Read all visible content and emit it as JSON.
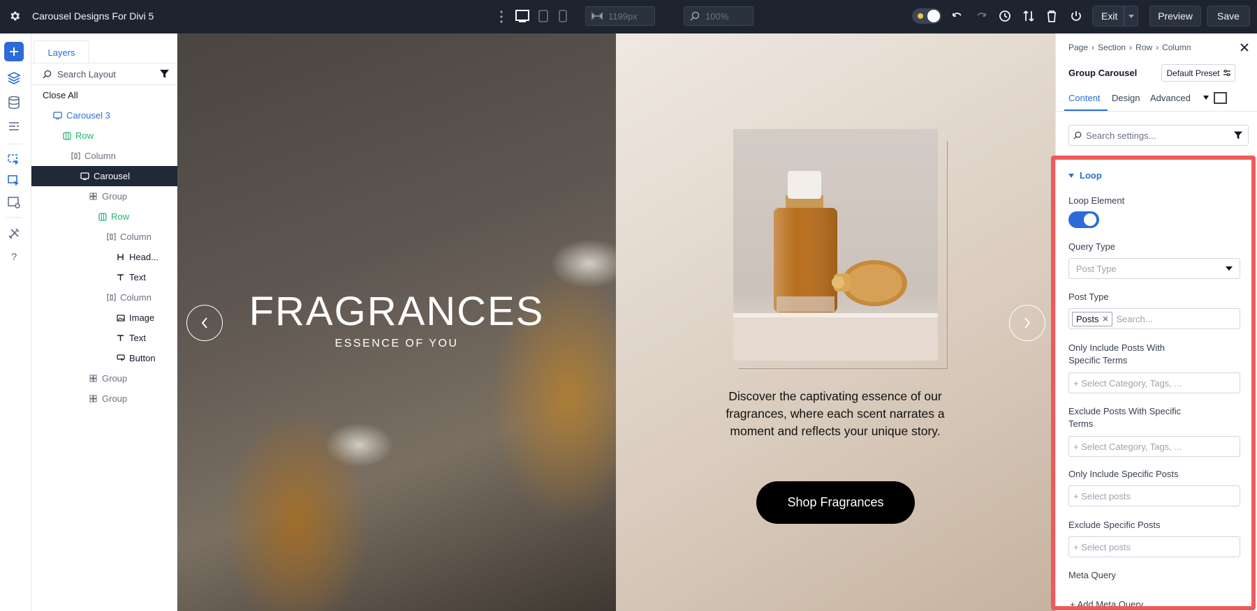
{
  "app": {
    "title": "Carousel Designs For Divi 5"
  },
  "toolbar": {
    "width_value": "1199px",
    "zoom_value": "100%",
    "exit_label": "Exit",
    "preview_label": "Preview",
    "save_label": "Save"
  },
  "layers": {
    "tab_label": "Layers",
    "search_placeholder": "Search Layout",
    "close_all": "Close All",
    "items": [
      {
        "label": "Carousel 3",
        "color": "#2b6cd9",
        "icon": "carousel-icon"
      },
      {
        "label": "Row",
        "color": "#22b573",
        "icon": "row-icon"
      },
      {
        "label": "Column",
        "color": "#6b7280",
        "icon": "column-icon"
      },
      {
        "label": "Carousel",
        "color": "#ffffff",
        "icon": "carousel-icon"
      },
      {
        "label": "Group",
        "color": "#6b7280",
        "icon": "group-icon"
      },
      {
        "label": "Row",
        "color": "#22b573",
        "icon": "row-icon"
      },
      {
        "label": "Column",
        "color": "#6b7280",
        "icon": "column-icon"
      },
      {
        "label": "Head...",
        "color": "#111827",
        "icon": "heading-icon"
      },
      {
        "label": "Text",
        "color": "#111827",
        "icon": "text-icon"
      },
      {
        "label": "Column",
        "color": "#6b7280",
        "icon": "column-icon"
      },
      {
        "label": "Image",
        "color": "#111827",
        "icon": "image-icon"
      },
      {
        "label": "Text",
        "color": "#111827",
        "icon": "text-icon"
      },
      {
        "label": "Button",
        "color": "#111827",
        "icon": "button-icon"
      },
      {
        "label": "Group",
        "color": "#6b7280",
        "icon": "group-icon"
      },
      {
        "label": "Group",
        "color": "#6b7280",
        "icon": "group-icon"
      }
    ]
  },
  "canvas": {
    "hero_title": "FRAGRANCES",
    "hero_subtitle": "ESSENCE OF YOU",
    "description": "Discover the captivating essence of our fragrances, where each scent narrates a moment and reflects your unique story.",
    "button_label": "Shop Fragrances"
  },
  "settings": {
    "breadcrumb": [
      "Page",
      "Section",
      "Row",
      "Column"
    ],
    "module_title": "Group Carousel",
    "preset_label": "Default Preset",
    "tabs": [
      "Content",
      "Design",
      "Advanced"
    ],
    "search_placeholder": "Search settings...",
    "section_title": "Loop",
    "loop_element_label": "Loop Element",
    "loop_element_on": true,
    "query_type_label": "Query Type",
    "query_type_value": "Post Type",
    "post_type_label": "Post Type",
    "post_type_chip": "Posts",
    "post_type_search": "Search...",
    "include_terms_label_1": "Only Include Posts With",
    "include_terms_label_2": "Specific Terms",
    "include_terms_placeholder": "+ Select Category, Tags, ...",
    "exclude_terms_label_1": "Exclude Posts With Specific",
    "exclude_terms_label_2": "Terms",
    "exclude_terms_placeholder": "+ Select Category, Tags, ...",
    "include_posts_label": "Only Include Specific Posts",
    "include_posts_placeholder": "+ Select posts",
    "exclude_posts_label": "Exclude Specific Posts",
    "exclude_posts_placeholder": "+ Select posts",
    "meta_query_label": "Meta Query",
    "add_meta_label": "+ Add Meta Query"
  },
  "colors": {
    "accent": "#2b6cd9",
    "highlight": "#ef5a5a",
    "save_bg": "#2a3240"
  }
}
